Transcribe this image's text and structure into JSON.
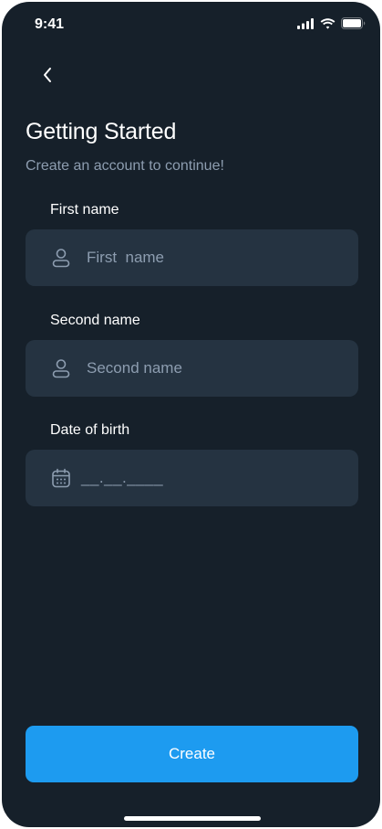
{
  "status_bar": {
    "time": "9:41",
    "icons": [
      "cellular-signal-icon",
      "wifi-icon",
      "battery-icon"
    ]
  },
  "nav": {
    "back_icon": "chevron-left-icon"
  },
  "header": {
    "title": "Getting Started",
    "subtitle": "Create an account to continue!"
  },
  "form": {
    "first_name": {
      "label": "First name",
      "placeholder": "First  name",
      "icon": "user-icon"
    },
    "second_name": {
      "label": "Second name",
      "placeholder": "Second name",
      "icon": "user-icon"
    },
    "date_of_birth": {
      "label": "Date of birth",
      "mask": "__.__.____",
      "icon": "calendar-icon"
    }
  },
  "actions": {
    "create_label": "Create"
  },
  "colors": {
    "background": "#16202a",
    "field_background": "#253341",
    "muted_text": "#8d9db0",
    "primary": "#1d9bf0",
    "text": "#ffffff"
  }
}
